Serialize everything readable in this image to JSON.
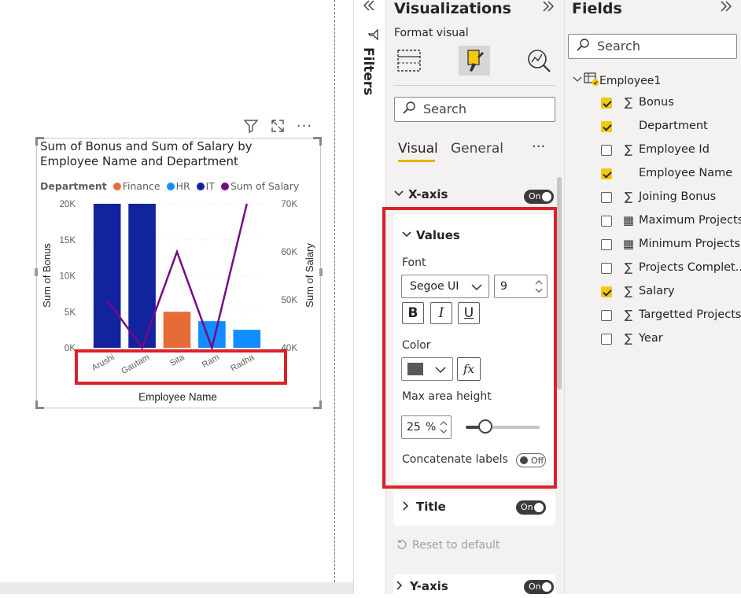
{
  "chart": {
    "title": "Sum of Bonus and Sum of Salary by Employee Name and Department",
    "legend_title": "Department",
    "legend": [
      {
        "label": "Finance",
        "color": "#e66c37"
      },
      {
        "label": "HR",
        "color": "#118dff"
      },
      {
        "label": "IT",
        "color": "#12239e"
      },
      {
        "label": "Sum of Salary",
        "color": "#750985"
      }
    ],
    "header_icons": [
      "filter-icon",
      "focus-mode-icon",
      "more-options-icon"
    ]
  },
  "chart_data": {
    "type": "bar",
    "title": "Sum of Bonus and Sum of Salary by Employee Name and Department",
    "xlabel": "Employee Name",
    "ylabel": "Sum of Bonus",
    "y2label": "Sum of Salary",
    "categories": [
      "Arushi",
      "Gautam",
      "Sita",
      "Ram",
      "Radha"
    ],
    "ylim": [
      0,
      20000
    ],
    "y2lim": [
      40000,
      70000
    ],
    "yticks": [
      "0K",
      "5K",
      "10K",
      "15K",
      "20K"
    ],
    "y2ticks": [
      "40K",
      "50K",
      "60K",
      "70K"
    ],
    "series": [
      {
        "name": "IT",
        "type": "bar",
        "color": "#12239e",
        "values": [
          20000,
          20000,
          null,
          null,
          null
        ]
      },
      {
        "name": "Finance",
        "type": "bar",
        "color": "#e66c37",
        "values": [
          null,
          null,
          5000,
          null,
          null
        ]
      },
      {
        "name": "HR",
        "type": "bar",
        "color": "#118dff",
        "values": [
          null,
          null,
          null,
          3700,
          2500
        ]
      },
      {
        "name": "Sum of Salary",
        "type": "line",
        "axis": "secondary",
        "color": "#750985",
        "values": [
          50000,
          40000,
          60000,
          40000,
          70000
        ]
      }
    ],
    "legend_position": "top-left",
    "grid": true
  },
  "filters": {
    "label": "Filters",
    "collapse_icon": "double-chevron-left-icon"
  },
  "visualizations": {
    "title": "Visualizations",
    "subtitle": "Format visual",
    "search_placeholder": "Search",
    "tabs": [
      "Visual",
      "General"
    ],
    "more": "···",
    "xaxis": {
      "label": "X-axis",
      "toggle": "On"
    },
    "values": {
      "label": "Values",
      "font_label": "Font",
      "font_family": "Segoe UI",
      "font_size": "9",
      "bold": "B",
      "italic": "I",
      "underline": "U",
      "color_label": "Color",
      "color_value": "#595959",
      "fx": "fx",
      "max_height_label": "Max area height",
      "max_height_value": "25",
      "max_height_unit": "%",
      "max_height_fraction": 0.25,
      "concat_label": "Concatenate labels",
      "concat_toggle": "Off"
    },
    "title_section": {
      "label": "Title",
      "toggle": "On"
    },
    "reset": "Reset to default",
    "yaxis": {
      "label": "Y-axis",
      "toggle": "On"
    }
  },
  "fields": {
    "title": "Fields",
    "search_placeholder": "Search",
    "table": "Employee1",
    "items": [
      {
        "name": "Bonus",
        "checked": true,
        "icon": "sigma-icon"
      },
      {
        "name": "Department",
        "checked": true,
        "icon": ""
      },
      {
        "name": "Employee Id",
        "checked": false,
        "icon": "sigma-icon"
      },
      {
        "name": "Employee Name",
        "checked": true,
        "icon": ""
      },
      {
        "name": "Joining Bonus",
        "checked": false,
        "icon": "sigma-icon"
      },
      {
        "name": "Maximum Projects",
        "checked": false,
        "icon": "calculator-icon"
      },
      {
        "name": "Minimum Projects",
        "checked": false,
        "icon": "calculator-icon"
      },
      {
        "name": "Projects Complet...",
        "checked": false,
        "icon": "sigma-icon"
      },
      {
        "name": "Salary",
        "checked": true,
        "icon": "sigma-icon"
      },
      {
        "name": "Targetted Projects",
        "checked": false,
        "icon": "sigma-icon"
      },
      {
        "name": "Year",
        "checked": false,
        "icon": "sigma-icon"
      }
    ]
  }
}
